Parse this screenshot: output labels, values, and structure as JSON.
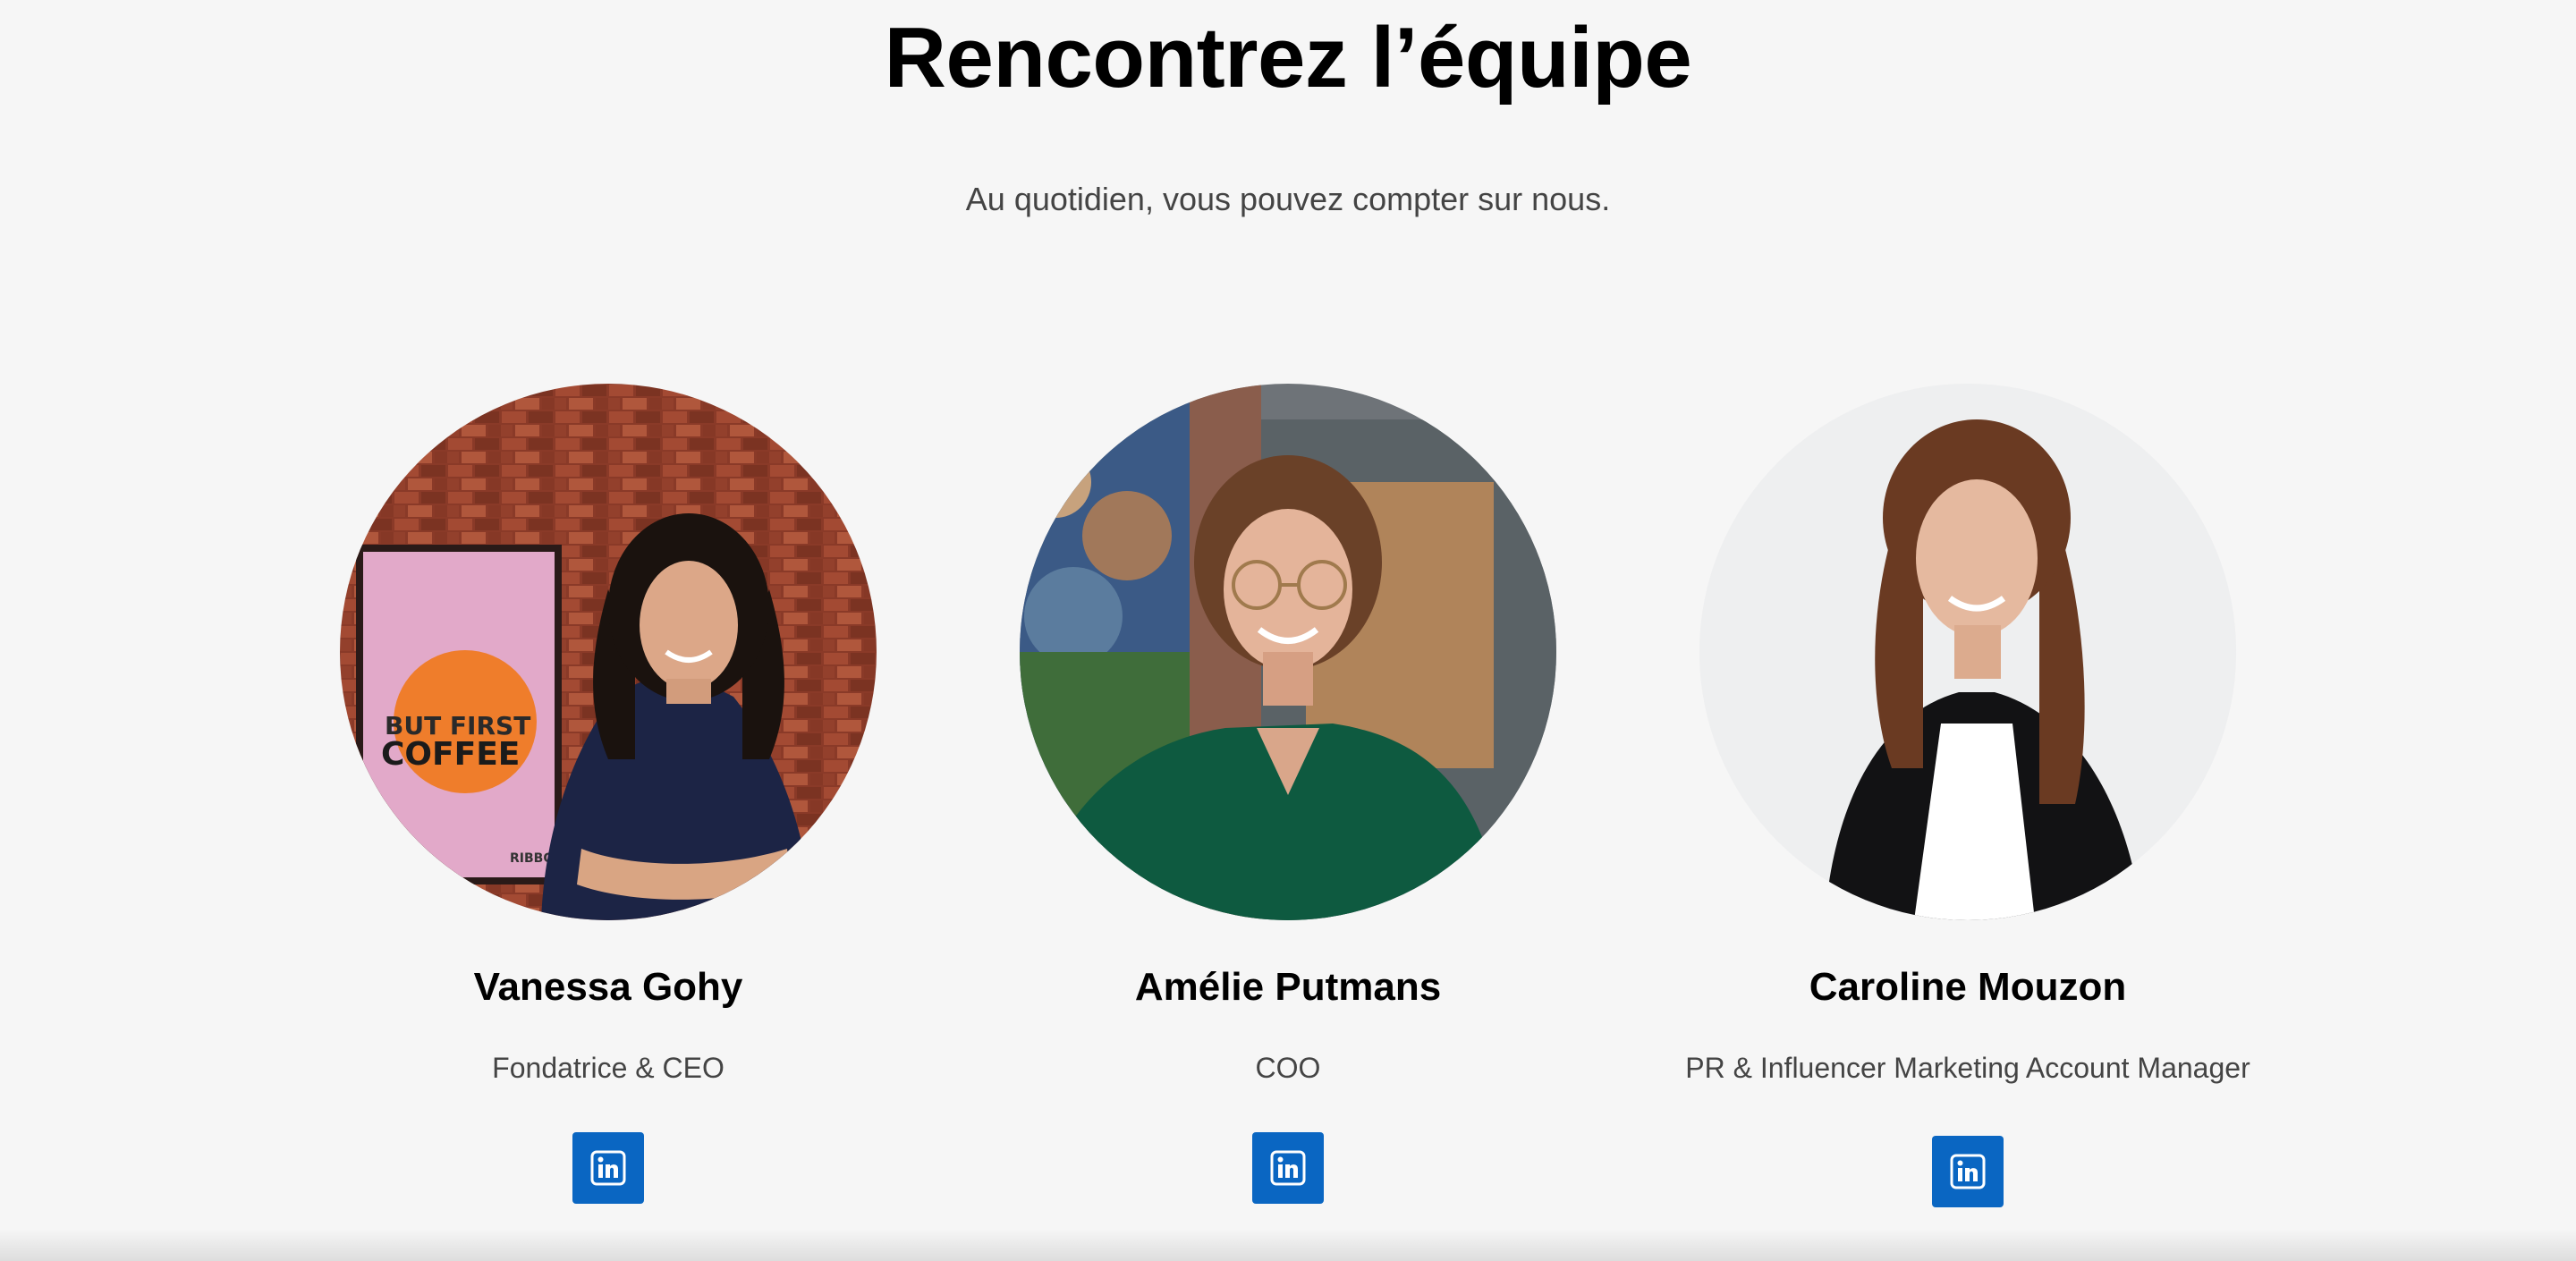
{
  "section": {
    "title": "Rencontrez l’équipe",
    "subtitle": "Au quotidien, vous pouvez compter sur nous."
  },
  "team": [
    {
      "name": "Vanessa Gohy",
      "role": "Fondatrice & CEO",
      "photo_text_line1": "BUT FIRST",
      "photo_text_line2": "COFFEE",
      "photo_text_brand": "RIBBON",
      "social_icon": "linkedin-icon"
    },
    {
      "name": "Amélie Putmans",
      "role": "COO",
      "social_icon": "linkedin-icon"
    },
    {
      "name": "Caroline Mouzon",
      "role": "PR & Influencer Marketing Account Manager",
      "social_icon": "linkedin-icon"
    }
  ],
  "colors": {
    "background": "#f6f6f6",
    "linkedin": "#0a66c2",
    "text_primary": "#000000",
    "text_secondary": "#444444"
  }
}
